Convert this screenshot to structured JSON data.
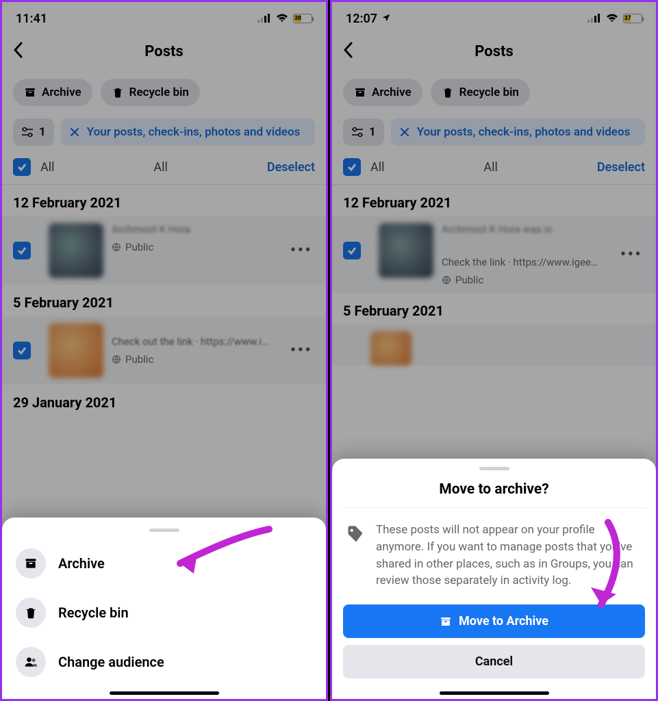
{
  "left": {
    "status": {
      "time": "11:41",
      "battery_pct": "38"
    },
    "header": {
      "title": "Posts"
    },
    "chips": {
      "archive": "Archive",
      "recycle": "Recycle bin"
    },
    "filter": {
      "count": "1",
      "banner": "Your posts, check-ins, photos and videos"
    },
    "select": {
      "all1": "All",
      "all2": "All",
      "deselect": "Deselect"
    },
    "dates": {
      "d1": "12 February 2021",
      "d2": "5 February 2021",
      "d3": "29 January 2021"
    },
    "post1": {
      "line1": "Archmoot K Hora",
      "line2": "",
      "privacy": "Public"
    },
    "post2": {
      "line1": "",
      "line2": "Check out the link · https://www.i…",
      "privacy": "Public"
    },
    "sheet": {
      "archive": "Archive",
      "recycle": "Recycle bin",
      "audience": "Change audience"
    }
  },
  "right": {
    "status": {
      "time": "12:07",
      "battery_pct": "37"
    },
    "header": {
      "title": "Posts"
    },
    "chips": {
      "archive": "Archive",
      "recycle": "Recycle bin"
    },
    "filter": {
      "count": "1",
      "banner": "Your posts, check-ins, photos and videos"
    },
    "select": {
      "all1": "All",
      "all2": "All",
      "deselect": "Deselect"
    },
    "dates": {
      "d1": "12 February 2021",
      "d2": "5 February 2021"
    },
    "post1": {
      "line1": "Archmoot K Hora was in",
      "line2": "Check the link · https://www.igee…",
      "privacy": "Public"
    },
    "sheet": {
      "title": "Move to archive?",
      "desc": "These posts will not appear on your profile anymore. If you want to manage posts that you've shared in other places, such as in Groups, you can review those separately in activity log.",
      "move": "Move to Archive",
      "cancel": "Cancel"
    }
  }
}
